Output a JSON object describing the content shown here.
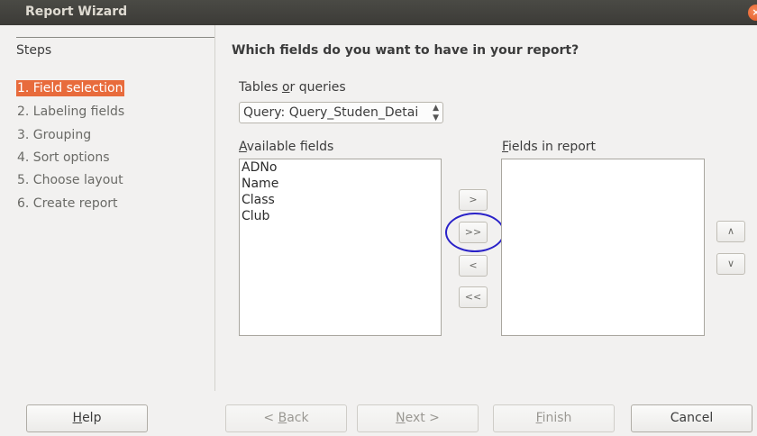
{
  "window": {
    "title": "Report Wizard",
    "close_glyph": "×"
  },
  "sidebar": {
    "heading": "Steps",
    "steps": [
      {
        "label": "1. Field selection",
        "active": true
      },
      {
        "label": "2. Labeling fields"
      },
      {
        "label": "3. Grouping"
      },
      {
        "label": "4. Sort options"
      },
      {
        "label": "5. Choose layout"
      },
      {
        "label": "6. Create report"
      }
    ]
  },
  "main": {
    "heading": "Which fields do you want to have in your report?",
    "tables_label_pre": "Tables ",
    "tables_label_u": "o",
    "tables_label_post": "r queries",
    "query_select": {
      "value": "Query: Query_Studen_Detai",
      "arrows": "⌃⌄"
    },
    "available_label_u": "A",
    "available_label_rest": "vailable fields",
    "available_fields": [
      "ADNo",
      "Name",
      "Class",
      "Club"
    ],
    "report_label_u": "F",
    "report_label_rest": "ields in report",
    "report_fields": [],
    "move_buttons": {
      "add": ">",
      "add_all": ">>",
      "remove": "<",
      "remove_all": "<<"
    },
    "order_buttons": {
      "up": "∧",
      "down": "∨"
    }
  },
  "footer": {
    "help_u": "H",
    "help_rest": "elp",
    "back_pre": "< ",
    "back_u": "B",
    "back_rest": "ack",
    "next_u": "N",
    "next_rest": "ext >",
    "finish_u": "F",
    "finish_rest": "inish",
    "cancel": "Cancel"
  },
  "colors": {
    "accent": "#e86b3c",
    "highlight_ring": "#2a22c8",
    "titlebar": "#3c3b37"
  }
}
